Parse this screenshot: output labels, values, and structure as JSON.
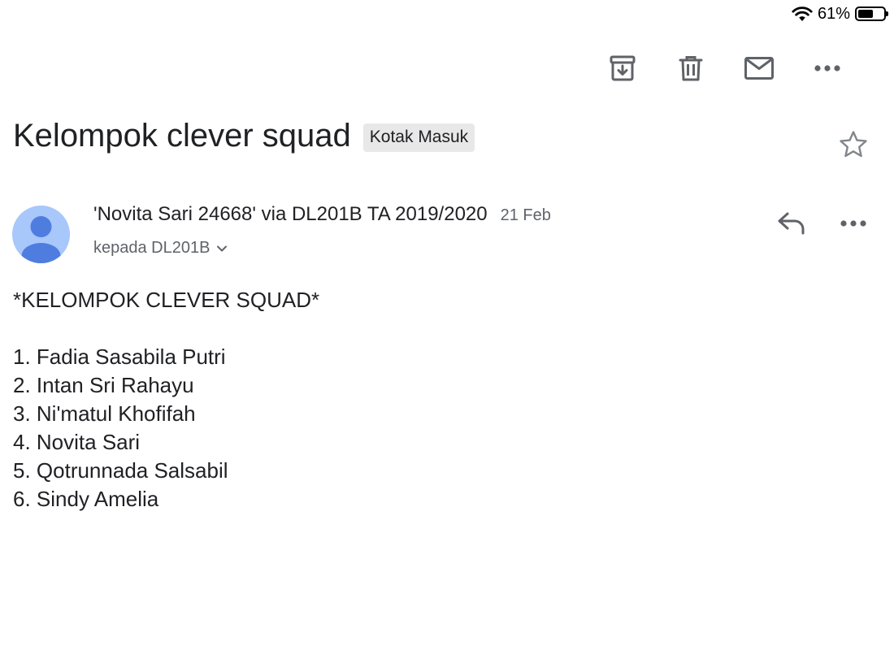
{
  "status_bar": {
    "battery_text": "61%",
    "battery_level": 0.61
  },
  "toolbar": {
    "icons": [
      "archive-icon",
      "trash-icon",
      "mail-icon",
      "more-icon"
    ]
  },
  "email": {
    "subject": "Kelompok clever squad",
    "label": "Kotak Masuk",
    "sender": "'Novita Sari 24668' via DL201B TA 2019/2020",
    "date": "21 Feb",
    "recipient": "kepada DL201B",
    "body_heading": "*KELOMPOK CLEVER SQUAD*",
    "members": [
      "1. Fadia Sasabila Putri",
      "2. Intan Sri Rahayu",
      "3. Ni'matul Khofifah",
      "4. Novita Sari",
      "5. Qotrunnada Salsabil",
      "6. Sindy Amelia"
    ]
  },
  "colors": {
    "avatar_bg": "#a8c7fa",
    "avatar_fg": "#4f7ddf",
    "icon_gray": "#5f6368",
    "chip_bg": "#e8e8e8"
  }
}
